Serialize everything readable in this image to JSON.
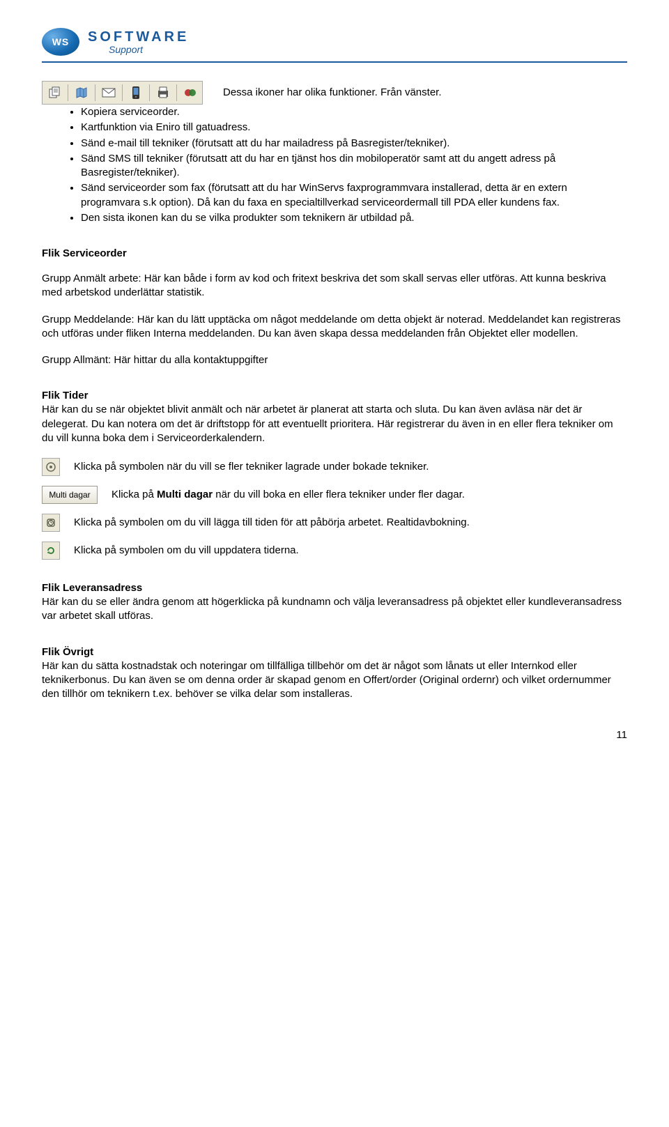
{
  "logo": {
    "badge": "WS",
    "title": "SOFTWARE",
    "sub": "Support"
  },
  "intro_line": "Dessa ikoner har olika funktioner. Från vänster.",
  "toolbar_icons": [
    "copy-icon",
    "map-icon",
    "mail-icon",
    "mobile-sms-icon",
    "fax-icon",
    "products-icon"
  ],
  "bullets": [
    "Kopiera serviceorder.",
    "Kartfunktion via Eniro till gatuadress.",
    "Sänd e-mail till tekniker (förutsatt att du har mailadress på Basregister/tekniker).",
    "Sänd SMS till tekniker (förutsatt att du har en tjänst hos din mobiloperatör samt att du angett adress på Basregister/tekniker).",
    "Sänd serviceorder som fax (förutsatt att du har WinServs faxprogrammvara installerad, detta är en extern programvara s.k option). Då kan du faxa en specialtillverkad serviceordermall till PDA eller kundens fax.",
    "Den sista ikonen kan du se vilka produkter som teknikern är utbildad på."
  ],
  "serviceorder": {
    "heading": "Flik Serviceorder",
    "p1": "Grupp Anmält arbete: Här kan både i form av kod och fritext beskriva det som skall servas eller utföras. Att kunna beskriva med arbetskod underlättar statistik.",
    "p2": "Grupp Meddelande: Här kan du lätt upptäcka om något meddelande om detta objekt är noterad. Meddelandet kan registreras och utföras under fliken Interna meddelanden. Du kan även skapa dessa meddelanden från Objektet eller modellen.",
    "p3": "Grupp Allmänt: Här hittar du alla kontaktuppgifter"
  },
  "tider": {
    "heading": "Flik Tider",
    "body": "Här kan du se när objektet blivit anmält och när arbetet är planerat att starta och sluta. Du kan även avläsa när det är delegerat. Du kan notera om det är driftstopp för att eventuellt prioritera. Här registrerar du även in en eller flera tekniker om du vill kunna boka dem i Serviceorderkalendern.",
    "line1": "Klicka på symbolen när du vill se fler tekniker lagrade under bokade tekniker.",
    "line2_pre": "Klicka på ",
    "line2_bold": "Multi dagar",
    "line2_post": " när du vill boka en eller flera tekniker under fler dagar.",
    "multi_label": "Multi dagar",
    "line3": "Klicka på symbolen om du vill lägga till tiden för att påbörja arbetet. Realtidavbokning.",
    "line4": "Klicka på symbolen om du vill uppdatera tiderna."
  },
  "levadr": {
    "heading": "Flik Leveransadress",
    "body": "Här kan du se eller ändra genom att högerklicka på kundnamn och välja leveransadress på objektet eller kundleveransadress var arbetet skall utföras."
  },
  "ovrigt": {
    "heading": "Flik Övrigt",
    "body": "Här kan du sätta kostnadstak och noteringar om tillfälliga tillbehör om det är något som lånats ut eller Internkod eller teknikerbonus. Du kan även se om denna order är skapad genom en Offert/order (Original ordernr) och vilket ordernummer den tillhör om teknikern t.ex. behöver se vilka delar som installeras."
  },
  "page_number": "11"
}
